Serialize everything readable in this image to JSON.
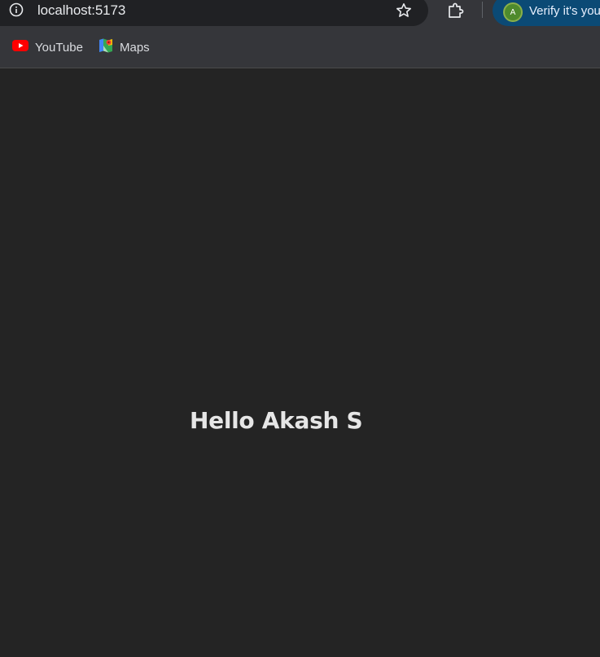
{
  "browser": {
    "address_bar": {
      "url": "localhost:5173",
      "info_icon": "info-icon",
      "bookmark_icon": "star-icon"
    },
    "extensions_icon": "puzzle-piece-icon",
    "profile": {
      "avatar_letter": "A",
      "verify_text": "Verify it's you",
      "accent_color": "#0b4a75"
    },
    "bookmarks": [
      {
        "label": "YouTube",
        "icon": "youtube-icon"
      },
      {
        "label": "Maps",
        "icon": "google-maps-icon"
      }
    ]
  },
  "page": {
    "heading": "Hello Akash S",
    "background_color": "#242424"
  }
}
